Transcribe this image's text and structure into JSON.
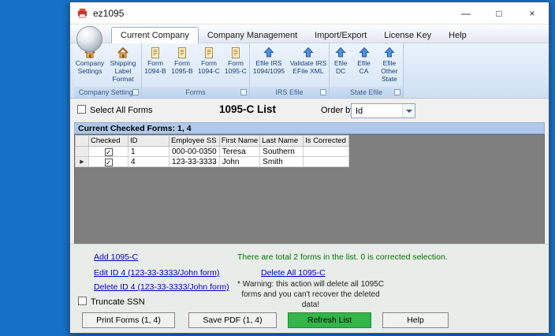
{
  "window": {
    "title": "ez1095",
    "controls": {
      "minimize": "—",
      "maximize": "□",
      "close": "×"
    }
  },
  "tabs": [
    {
      "label": "Current Company"
    },
    {
      "label": "Company Management"
    },
    {
      "label": "Import/Export"
    },
    {
      "label": "License Key"
    },
    {
      "label": "Help"
    }
  ],
  "ribbon": {
    "groups": [
      {
        "label": "Company Settings",
        "buttons": [
          {
            "label": "Company Settings",
            "icon": "home-icon"
          },
          {
            "label": "Shipping Label Format",
            "icon": "home-icon"
          }
        ]
      },
      {
        "label": "Forms",
        "buttons": [
          {
            "label": "Form 1094-B",
            "icon": "form-icon"
          },
          {
            "label": "Form 1095-B",
            "icon": "form-icon"
          },
          {
            "label": "Form 1094-C",
            "icon": "form-icon"
          },
          {
            "label": "Form 1095-C",
            "icon": "form-icon"
          }
        ]
      },
      {
        "label": "IRS Efile",
        "buttons": [
          {
            "label": "Efile IRS 1094/1095",
            "icon": "upload-arrow-icon"
          },
          {
            "label": "Validate IRS EFile XML",
            "icon": "upload-arrow-icon"
          }
        ]
      },
      {
        "label": "State Efile",
        "buttons": [
          {
            "label": "Efile DC",
            "icon": "upload-arrow-icon"
          },
          {
            "label": "Efile CA",
            "icon": "upload-arrow-icon"
          },
          {
            "label": "Efile Other State",
            "icon": "upload-arrow-icon"
          }
        ]
      }
    ]
  },
  "listbar": {
    "select_all_label": "Select All Forms",
    "title": "1095-C List",
    "order_by_label": "Order by",
    "order_by_value": "Id"
  },
  "grid": {
    "status_header": "Current Checked Forms: 1, 4",
    "columns": [
      "Checked",
      "ID",
      "Employee SS",
      "First Name",
      "Last Name",
      "Is Corrected"
    ],
    "rows": [
      {
        "marker": "",
        "check": "✓",
        "id": "1",
        "employee_ss": "000-00-0350",
        "first_name": "Teresa",
        "last_name": "Southern",
        "is_corrected": ""
      },
      {
        "marker": "▶",
        "check": "✓",
        "id": "4",
        "employee_ss": "123-33-3333",
        "first_name": "John",
        "last_name": "Smith",
        "is_corrected": ""
      }
    ]
  },
  "footer": {
    "add_link": "Add 1095-C",
    "edit_link": "Edit ID 4 (123-33-3333/John form)",
    "delete_link": "Delete ID 4 (123-33-3333/John form)",
    "delete_all_link": "Delete All 1095-C",
    "summary": "There are total 2 forms in the list. 0 is corrected selection.",
    "warning": "* Warning: this action will delete all 1095C forms and you can't recover the deleted data!",
    "truncate_label": "Truncate SSN",
    "buttons": {
      "print": "Print Forms (1, 4)",
      "save_pdf": "Save PDF (1, 4)",
      "refresh": "Refresh List",
      "help": "Help"
    }
  },
  "colors": {
    "desktop": "#1571c8",
    "refresh_button_green": "#33b549",
    "summary_text_green": "#007700",
    "link_blue": "#0000cc",
    "status_band_blue": "#b1c8e8"
  }
}
